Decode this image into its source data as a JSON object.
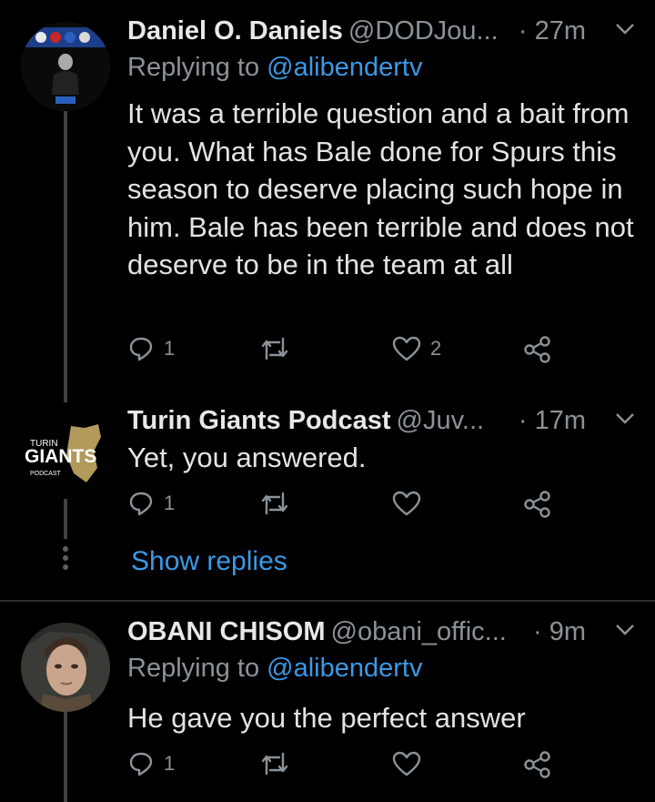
{
  "tweets": [
    {
      "name": "Daniel O. Daniels",
      "handle": "@DODJou...",
      "time": "· 27m",
      "replying_prefix": "Replying to",
      "replying_to": "@alibendertv",
      "text": "It was a terrible question and a bait from you. What has Bale done for Spurs this season to deserve placing such hope in him. Bale has been terrible and does not deserve to be in the team at all",
      "replies": "1",
      "retweets": "",
      "likes": "2"
    },
    {
      "name": "Turin Giants Podcast",
      "handle": "@Juv...",
      "time": "· 17m",
      "text": "Yet, you answered.",
      "replies": "1",
      "retweets": "",
      "likes": "",
      "avatar_text": {
        "top": "TURIN",
        "main": "GIANTS",
        "bottom": "PODCAST"
      }
    },
    {
      "name": "OBANI CHISOM",
      "handle": "@obani_offic...",
      "time": "· 9m",
      "replying_prefix": "Replying to",
      "replying_to": "@alibendertv",
      "text": "He gave you the perfect answer",
      "replies": "1",
      "retweets": "",
      "likes": ""
    }
  ],
  "show_replies": "Show replies",
  "colors": {
    "background": "#000000",
    "accent": "#3c99e6",
    "muted": "#8b9299",
    "text": "#e3e3e3"
  }
}
